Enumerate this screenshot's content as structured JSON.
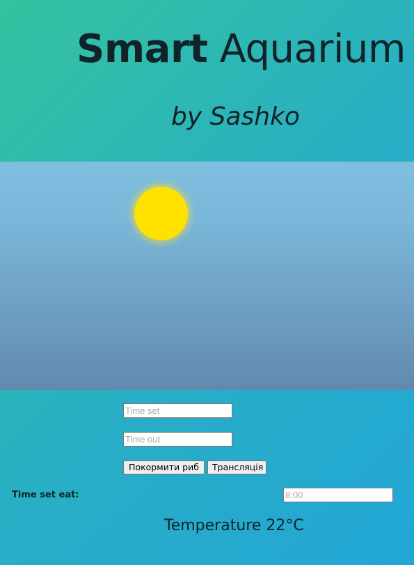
{
  "header": {
    "title_bold": "Smart",
    "title_rest": "Aquarium",
    "subtitle": "by Sashko"
  },
  "controls": {
    "time_set_placeholder": "Time set",
    "time_out_placeholder": "Time out",
    "feed_button": "Покормити риб",
    "stream_button": "Трансляція",
    "eat_label": "Time set eat:",
    "eat_placeholder": "8:00",
    "temperature": "Temperature 22°C"
  },
  "colors": {
    "background_gradient_start": "#35c29f",
    "background_gradient_end": "#22a6d6",
    "sky_top": "#7fbfe0",
    "sky_bottom": "#6189ad",
    "sun": "#ffe100",
    "text": "#0f2328"
  }
}
